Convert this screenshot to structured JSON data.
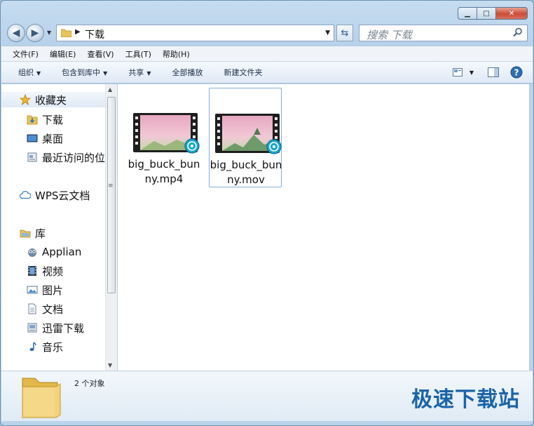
{
  "window": {
    "caption": {
      "minimize": "▁",
      "maximize": "□",
      "close": "✕"
    }
  },
  "address_bar": {
    "path": "下载"
  },
  "search": {
    "placeholder": "搜索 下载"
  },
  "menu": [
    "文件(F)",
    "编辑(E)",
    "查看(V)",
    "工具(T)",
    "帮助(H)"
  ],
  "toolbar": {
    "organize": "组织",
    "include_in_library": "包含到库中",
    "share": "共享",
    "play_all": "全部播放",
    "new_folder": "新建文件夹"
  },
  "nav_pane": {
    "favorites": "收藏夹",
    "favorites_items": [
      "下载",
      "桌面",
      "最近访问的位"
    ],
    "wps": "WPS云文档",
    "libraries": "库",
    "library_items": [
      "Applian",
      "视频",
      "图片",
      "文档",
      "迅雷下载",
      "音乐"
    ]
  },
  "files": [
    {
      "name": "big_buck_bunny.mp4",
      "selected": false
    },
    {
      "name": "big_buck_bunny.mov",
      "selected": true
    }
  ],
  "details": {
    "count": "2 个对象"
  },
  "watermark": "极速下载站",
  "colors": {
    "accent": "#1a64a8",
    "selection": "#84acdd"
  }
}
